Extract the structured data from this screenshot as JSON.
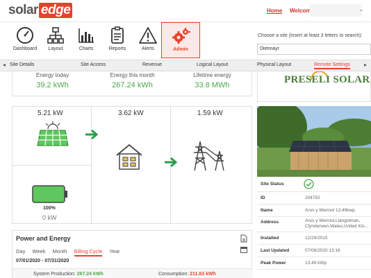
{
  "header": {
    "logo_solar": "solar",
    "logo_edge": "edge",
    "home": "Home",
    "welcome": "Welcome"
  },
  "nav": [
    {
      "label": "Dashboard",
      "icon": "gauge-icon"
    },
    {
      "label": "Layout",
      "icon": "hierarchy-icon"
    },
    {
      "label": "Charts",
      "icon": "bar-chart-icon"
    },
    {
      "label": "Reports",
      "icon": "report-icon"
    },
    {
      "label": "Alerts",
      "icon": "warning-icon"
    },
    {
      "label": "Admin",
      "icon": "gears-icon"
    }
  ],
  "site_search": {
    "label": "Choose a site (insert at least 3 letters to search):",
    "value": "Dietmayr"
  },
  "tabs": [
    "Site Details",
    "Site Access",
    "Revenue",
    "Logical Layout",
    "Physical Layout",
    "Remote Settings"
  ],
  "energy": {
    "today_title": "Energy today",
    "today_value": "39.2 kWh",
    "month_title": "Energy this month",
    "month_value": "267.24 kWh",
    "lifetime_title": "Lifetime energy",
    "lifetime_value": "33.8 MWh"
  },
  "brand_logo": "PRESELI SOLAR",
  "flow": {
    "pv_power": "5.21 kW",
    "house_power": "3.62 kW",
    "grid_power": "1.59 kW",
    "battery_pct": "100%",
    "battery_power": "0 kW"
  },
  "details": {
    "status_label": "Site Status",
    "id_label": "ID",
    "id_value": "204782",
    "name_label": "Name",
    "name_value": "Aros y Wennol 13.49kwp",
    "address_label": "Address",
    "address_line1": "Aros y Wennol,Llangolman,",
    "address_line2": "Clynderwen,Wales,United Kin...",
    "installed_label": "Installed",
    "installed_value": "12/29/2015",
    "updated_label": "Last Updated",
    "updated_value": "07/06/2020 13:16",
    "peak_label": "Peak Power",
    "peak_value": "13.49 kWp"
  },
  "power_energy": {
    "title": "Power and Energy",
    "tabs": [
      "Day",
      "Week",
      "Month",
      "Billing Cycle",
      "Year"
    ],
    "range": "07/01/2020 - 07/31/2020",
    "production_label": "System Production:",
    "production_value": "267.24 kWh",
    "consumption_label": "Consumption:",
    "consumption_value": "211.63 kWh"
  },
  "colors": {
    "accent": "#e8412b",
    "green": "#4aa84a"
  }
}
